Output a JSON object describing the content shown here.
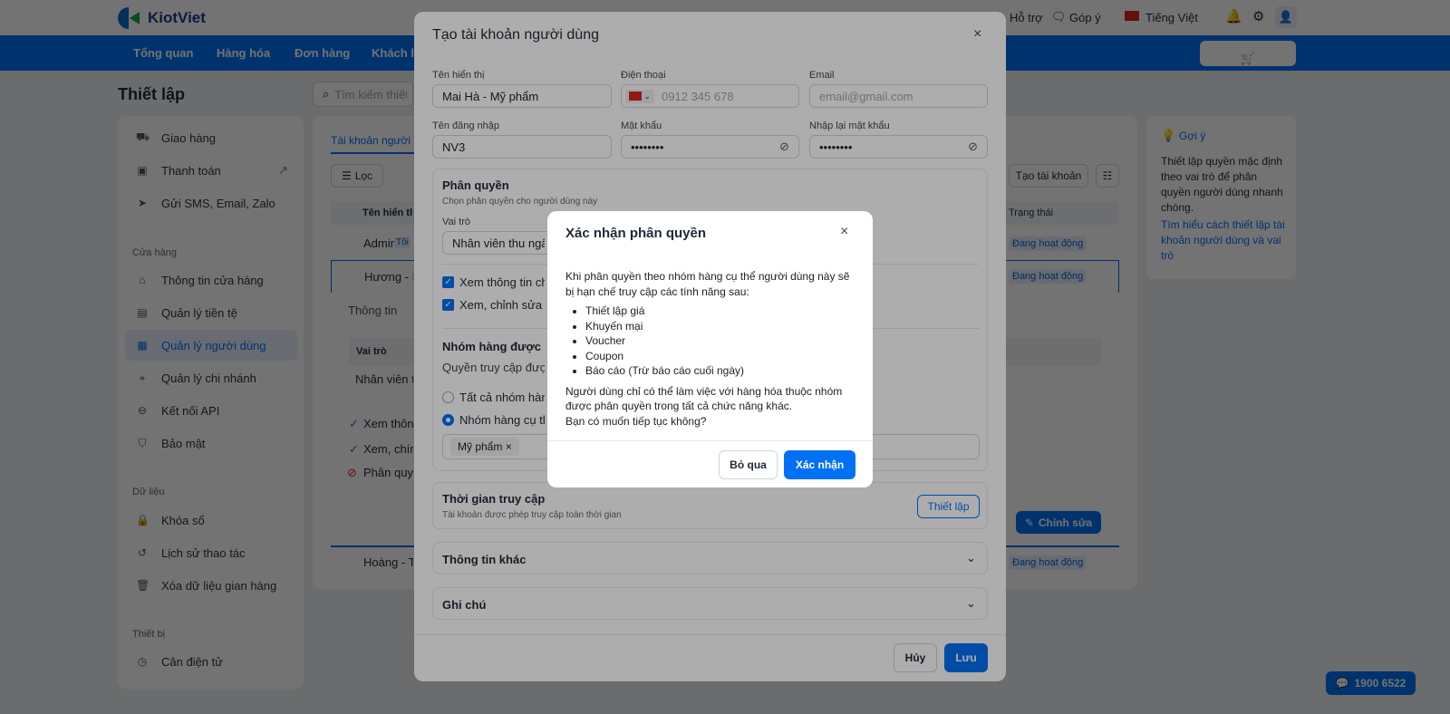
{
  "app": {
    "brand": "KiotViet",
    "top_links": [
      "Hỗ trợ",
      "Góp ý"
    ],
    "language": "Tiếng Việt",
    "colors": {
      "primary": "#0070f4"
    }
  },
  "nav": {
    "items": [
      "Tổng quan",
      "Hàng hóa",
      "Đơn hàng",
      "Khách h"
    ],
    "sell_button": "Bán hàng"
  },
  "page": {
    "title": "Thiết lập",
    "search_placeholder": "Tìm kiếm thiết l"
  },
  "sidebar": {
    "items": [
      {
        "label": "Giao hàng",
        "icon": "truck-icon"
      },
      {
        "label": "Thanh toán",
        "icon": "payment-icon"
      },
      {
        "label": "Gửi SMS, Email, Zalo",
        "icon": "send-icon"
      }
    ],
    "groups": [
      {
        "title": "Cửa hàng",
        "items": [
          {
            "label": "Thông tin cửa hàng"
          },
          {
            "label": "Quản lý tiền tệ"
          },
          {
            "label": "Quản lý người dùng",
            "active": true
          },
          {
            "label": "Quản lý chi nhánh"
          },
          {
            "label": "Kết nối API"
          },
          {
            "label": "Bảo mật"
          }
        ]
      },
      {
        "title": "Dữ liệu",
        "items": [
          {
            "label": "Khóa sổ"
          },
          {
            "label": "Lịch sử thao tác"
          },
          {
            "label": "Xóa dữ liệu gian hàng"
          }
        ]
      },
      {
        "title": "Thiết bị",
        "items": [
          {
            "label": "Cân điện tử"
          }
        ]
      }
    ]
  },
  "main": {
    "tab": "Tài khoản người d",
    "filter": "Lọc",
    "create": "Tạo tài khoản",
    "col_name": "Tên hiển thị",
    "col_status": "Trạng thái",
    "rows": [
      {
        "name": "Admin",
        "tag": "Tôi",
        "status": "Đang hoạt động"
      },
      {
        "name": "Hương - M",
        "status": "Đang hoạt động"
      },
      {
        "name": "Hoàng - T",
        "status": "Đang hoạt động"
      }
    ],
    "detail": {
      "tab": "Thông tin",
      "role_header": "Vai trò",
      "role": "Nhân viên th",
      "perms": [
        "Xem thông",
        "Xem, chính",
        "Phân quyề"
      ],
      "edit": "Chỉnh sửa"
    }
  },
  "hint": {
    "title": "Gợi ý",
    "text": "Thiết lập quyền mặc định theo vai trò để phân quyền người dùng nhanh chóng.",
    "link": "Tìm hiểu cách thiết lập tài khoản người dùng và vai trò"
  },
  "modal": {
    "title": "Tạo tài khoản người dùng",
    "fields": {
      "display_name_label": "Tên hiển thị",
      "display_name": "Mai Hà - Mỹ phẩm",
      "phone_label": "Điện thoại",
      "phone_placeholder": "0912 345 678",
      "email_label": "Email",
      "email_placeholder": "email@gmail.com",
      "username_label": "Tên đăng nhập",
      "username": "NV3",
      "password_label": "Mật khẩu",
      "password": "••••••••",
      "repassword_label": "Nhập lại mật khẩu",
      "repassword": "••••••••"
    },
    "perm": {
      "title": "Phân quyền",
      "subtitle": "Chọn phân quyền cho người dùng này",
      "role_label": "Vai trò",
      "role": "Nhân viên thu ngân",
      "checks": [
        "Xem thông tin chu",
        "Xem, chỉnh sửa gia"
      ],
      "group_title": "Nhóm hàng được phé",
      "group_sub": "Quyền truy cập được",
      "radio_all": "Tất cả nhóm hàng",
      "radio_specific": "Nhóm hàng cụ thể",
      "selected_radio": "specific",
      "tag": "Mỹ phẩm"
    },
    "access": {
      "title": "Thời gian truy cập",
      "subtitle": "Tài khoản được phép truy cập toàn thời gian",
      "button": "Thiết lập"
    },
    "other": "Thông tin khác",
    "note": "Ghi chú",
    "cancel": "Hủy",
    "save": "Lưu"
  },
  "dialog": {
    "title": "Xác nhận phân quyền",
    "intro": "Khi phân quyền theo nhóm hàng cụ thể người dùng này sẽ bị hạn chế truy cập các tính năng sau:",
    "items": [
      "Thiết lập giá",
      "Khuyến mại",
      "Voucher",
      "Coupon",
      "Báo cáo (Trừ báo cáo cuối ngày)"
    ],
    "note": "Người dùng chỉ có thể làm việc với hàng hóa thuộc nhóm được phân quyền trong tất cả chức năng khác.",
    "question": "Bạn có muốn tiếp tục không?",
    "skip": "Bỏ qua",
    "confirm": "Xác nhận"
  },
  "hotline": "1900 6522"
}
